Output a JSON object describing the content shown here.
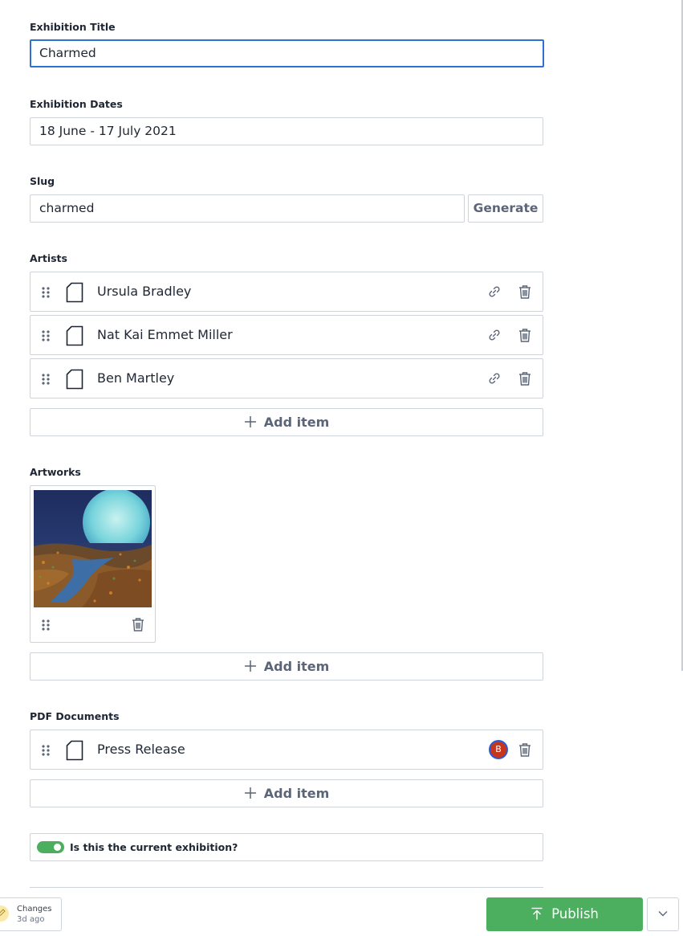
{
  "exhibition_title": {
    "label": "Exhibition Title",
    "value": "Charmed"
  },
  "exhibition_dates": {
    "label": "Exhibition Dates",
    "value": "18 June - 17 July 2021"
  },
  "slug": {
    "label": "Slug",
    "value": "charmed",
    "generate_label": "Generate"
  },
  "artists": {
    "label": "Artists",
    "items": [
      {
        "title": "Ursula Bradley"
      },
      {
        "title": "Nat Kai Emmet Miller"
      },
      {
        "title": "Ben Martley"
      }
    ],
    "add_label": "Add item"
  },
  "artworks": {
    "label": "Artworks",
    "items": [
      {
        "image": "moon-painting-thumbnail"
      }
    ],
    "add_label": "Add item"
  },
  "pdf_documents": {
    "label": "PDF Documents",
    "items": [
      {
        "title": "Press Release",
        "presence_avatar": "B"
      }
    ],
    "add_label": "Add item"
  },
  "current_exhibition": {
    "label": "Is this the current exhibition?",
    "checked": true
  },
  "footer": {
    "changes_label": "Changes",
    "changes_time": "3d ago",
    "publish_label": "Publish"
  },
  "colors": {
    "accent": "#2f6fd6",
    "publish": "#4cae5f",
    "border": "#cfd3da",
    "avatar": "#c5361c"
  }
}
